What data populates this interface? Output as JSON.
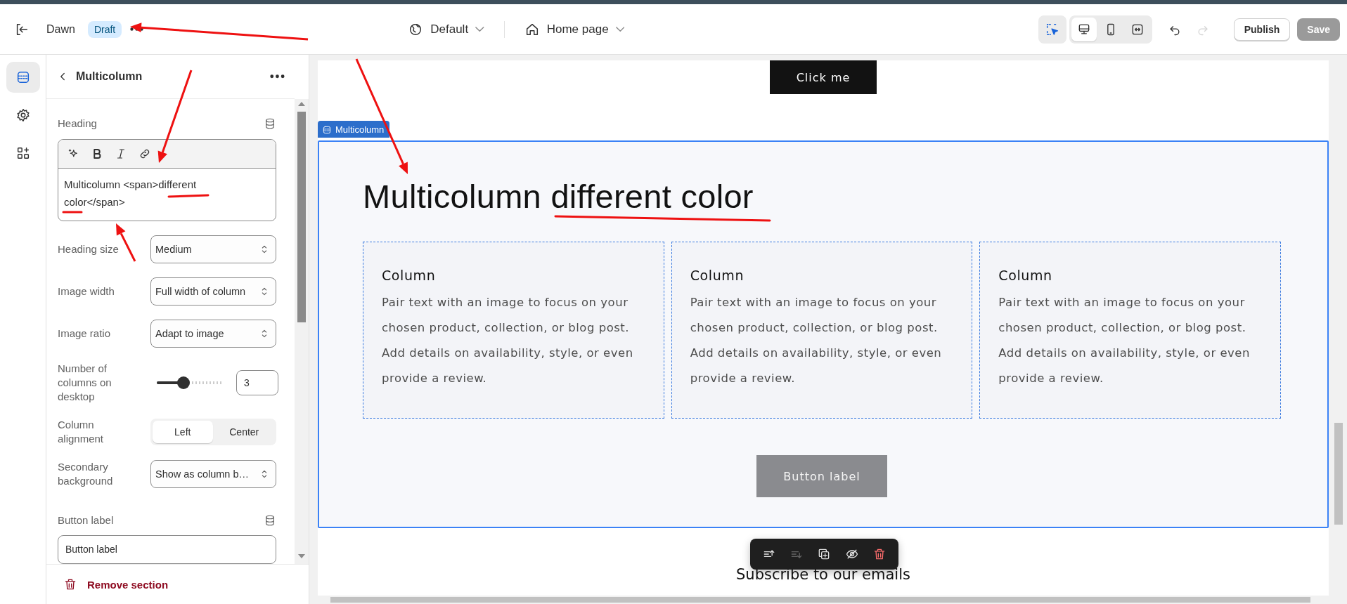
{
  "header": {
    "theme_name": "Dawn",
    "status_badge": "Draft",
    "theme_selector": "Default",
    "page_selector": "Home page",
    "inspect": {
      "on": true
    },
    "devices": [
      {
        "kind": "desktop",
        "selected": true
      },
      {
        "kind": "mobile",
        "selected": false
      },
      {
        "kind": "fullwidth",
        "selected": false
      }
    ],
    "undo": {
      "disabled": false
    },
    "redo": {
      "disabled": true
    },
    "publish": "Publish",
    "save": {
      "label": "Save",
      "disabled": true
    }
  },
  "rail": [
    {
      "kind": "sections",
      "selected": true
    },
    {
      "kind": "settings",
      "selected": false
    },
    {
      "kind": "apps",
      "selected": false
    }
  ],
  "panel": {
    "title": "Multicolumn",
    "heading_label": "Heading",
    "editor_tools": [
      {
        "kind": "ai"
      },
      {
        "kind": "bold"
      },
      {
        "kind": "italic"
      },
      {
        "kind": "link"
      }
    ],
    "heading_value": "Multicolumn <span>different color</span>",
    "settings": [
      {
        "kind": "select",
        "label": "Heading size",
        "value": "Medium"
      },
      {
        "kind": "select",
        "label": "Image width",
        "value": "Full width of column"
      },
      {
        "kind": "select",
        "label": "Image ratio",
        "value": "Adapt to image"
      },
      {
        "kind": "slider",
        "label": "Number of columns on desktop",
        "value": "3",
        "level": 0.4
      },
      {
        "kind": "segmented",
        "label": "Column alignment",
        "options": [
          {
            "label": "Left",
            "selected": true
          },
          {
            "label": "Center",
            "selected": false
          }
        ]
      },
      {
        "kind": "select",
        "label": "Secondary background",
        "value": "Show as column b…"
      }
    ],
    "button_label": {
      "label": "Button label",
      "value": "Button label"
    },
    "remove": "Remove section"
  },
  "preview": {
    "top_button": "Click me",
    "section_tag": "Multicolumn",
    "heading": "Multicolumn different color",
    "columns": [
      {
        "title": "Column",
        "text": "Pair text with an image to focus on your chosen product, collection, or blog post. Add details on availability, style, or even provide a review."
      },
      {
        "title": "Column",
        "text": "Pair text with an image to focus on your chosen product, collection, or blog post. Add details on availability, style, or even provide a review."
      },
      {
        "title": "Column",
        "text": "Pair text with an image to focus on your chosen product, collection, or blog post. Add details on availability, style, or even provide a review."
      }
    ],
    "button": "Button label",
    "next_section": "Subscribe to our emails",
    "toolbar": [
      {
        "kind": "move-up",
        "disabled": false
      },
      {
        "kind": "move-down",
        "disabled": true
      },
      {
        "kind": "duplicate",
        "disabled": false
      },
      {
        "kind": "hide",
        "disabled": false
      },
      {
        "kind": "delete",
        "disabled": false
      }
    ]
  },
  "annotations": [
    {
      "kind": "arrow"
    },
    {
      "kind": "arrow"
    },
    {
      "kind": "arrow"
    },
    {
      "kind": "arrow"
    },
    {
      "kind": "underline"
    },
    {
      "kind": "underline"
    },
    {
      "kind": "underline"
    }
  ]
}
